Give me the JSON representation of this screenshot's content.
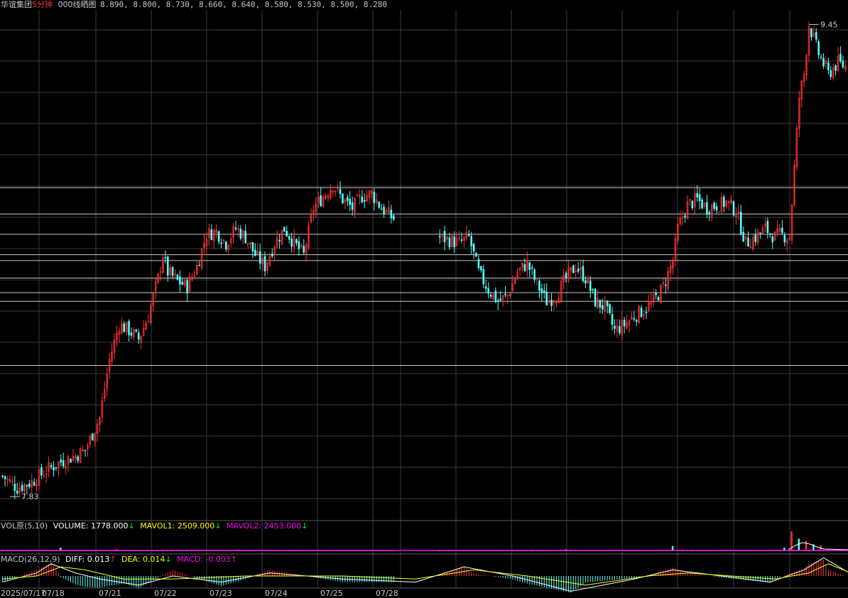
{
  "header": {
    "stock_name": "华谊集团",
    "period": "5分钟",
    "indicator_name": "000线晒图",
    "indicator_values": "8.890, 8.800, 8.730, 8.660, 8.640, 8.580, 8.530, 8.500, 8.280"
  },
  "vol_panel": {
    "name": "VOL原(5,10)",
    "volume_label": "VOLUME: 1778.000",
    "volume_arrow": "↓",
    "mavol1_label": "MAVOL1: 2509.000",
    "mavol1_arrow": "↓",
    "mavol2_label": "MAVOL2: 2453.000",
    "mavol2_arrow": "↓"
  },
  "macd_panel": {
    "name": "MACD(26,12,9)",
    "diff_label": "DIFF: 0.013",
    "diff_arrow": "↑",
    "dea_label": "DEA: 0.014",
    "dea_arrow": "↓",
    "macd_label": "MACD: -0.003",
    "macd_arrow": "↑"
  },
  "colors": {
    "background": "#000000",
    "up": "#ff3232",
    "down": "#54ffff",
    "grid": "#3c3c3c",
    "hline": "#c8c8c8",
    "mavol1": "#ffffff",
    "mavol2": "#ff00ff",
    "diff": "#ffff00",
    "dea": "#ffffff",
    "label_red": "#ff3232",
    "label_yellow": "#ffff00",
    "label_magenta": "#ff00ff",
    "label_green": "#00ff00"
  },
  "chart_data": {
    "type": "candlestick",
    "interval": "5min",
    "dates": [
      "2025/07/17",
      "07/18",
      "07/21",
      "07/22",
      "07/23",
      "07/24",
      "07/25",
      "07/28"
    ],
    "ylim": [
      7.75,
      9.5
    ],
    "high_label": "9.45",
    "low_label": "7.83",
    "levels": [
      8.89,
      8.8,
      8.73,
      8.66,
      8.64,
      8.58,
      8.53,
      8.5,
      8.28
    ],
    "close_path": [
      {
        "x": 0,
        "y": 7.9
      },
      {
        "x": 6,
        "y": 7.86
      },
      {
        "x": 12,
        "y": 7.88
      },
      {
        "x": 18,
        "y": 7.92
      },
      {
        "x": 24,
        "y": 7.95
      },
      {
        "x": 30,
        "y": 7.97
      },
      {
        "x": 34,
        "y": 7.99
      },
      {
        "x": 40,
        "y": 8.1
      },
      {
        "x": 44,
        "y": 8.3
      },
      {
        "x": 48,
        "y": 8.42
      },
      {
        "x": 52,
        "y": 8.4
      },
      {
        "x": 56,
        "y": 8.37
      },
      {
        "x": 60,
        "y": 8.45
      },
      {
        "x": 64,
        "y": 8.58
      },
      {
        "x": 66,
        "y": 8.66
      },
      {
        "x": 68,
        "y": 8.6
      },
      {
        "x": 72,
        "y": 8.57
      },
      {
        "x": 76,
        "y": 8.55
      },
      {
        "x": 80,
        "y": 8.62
      },
      {
        "x": 84,
        "y": 8.73
      },
      {
        "x": 88,
        "y": 8.74
      },
      {
        "x": 92,
        "y": 8.7
      },
      {
        "x": 96,
        "y": 8.75
      },
      {
        "x": 100,
        "y": 8.72
      },
      {
        "x": 104,
        "y": 8.66
      },
      {
        "x": 108,
        "y": 8.62
      },
      {
        "x": 112,
        "y": 8.7
      },
      {
        "x": 116,
        "y": 8.75
      },
      {
        "x": 120,
        "y": 8.7
      },
      {
        "x": 124,
        "y": 8.66
      },
      {
        "x": 128,
        "y": 8.82
      },
      {
        "x": 132,
        "y": 8.86
      },
      {
        "x": 136,
        "y": 8.9
      },
      {
        "x": 140,
        "y": 8.85
      },
      {
        "x": 144,
        "y": 8.82
      },
      {
        "x": 148,
        "y": 8.86
      },
      {
        "x": 152,
        "y": 8.87
      },
      {
        "x": 156,
        "y": 8.82
      },
      {
        "x": 160,
        "y": 8.79
      },
      {
        "x": 164,
        "y": 8.77
      },
      {
        "x": 168,
        "y": 8.76
      },
      {
        "x": 172,
        "y": 8.75
      },
      {
        "x": 176,
        "y": 8.74
      },
      {
        "x": 180,
        "y": 8.72
      },
      {
        "x": 184,
        "y": 8.71
      },
      {
        "x": 188,
        "y": 8.7
      },
      {
        "x": 192,
        "y": 8.72
      },
      {
        "x": 196,
        "y": 8.6
      },
      {
        "x": 200,
        "y": 8.54
      },
      {
        "x": 204,
        "y": 8.5
      },
      {
        "x": 208,
        "y": 8.52
      },
      {
        "x": 212,
        "y": 8.6
      },
      {
        "x": 216,
        "y": 8.63
      },
      {
        "x": 220,
        "y": 8.56
      },
      {
        "x": 224,
        "y": 8.5
      },
      {
        "x": 228,
        "y": 8.52
      },
      {
        "x": 232,
        "y": 8.58
      },
      {
        "x": 236,
        "y": 8.62
      },
      {
        "x": 240,
        "y": 8.58
      },
      {
        "x": 244,
        "y": 8.5
      },
      {
        "x": 248,
        "y": 8.48
      },
      {
        "x": 252,
        "y": 8.4
      },
      {
        "x": 256,
        "y": 8.42
      },
      {
        "x": 260,
        "y": 8.45
      },
      {
        "x": 264,
        "y": 8.47
      },
      {
        "x": 268,
        "y": 8.5
      },
      {
        "x": 272,
        "y": 8.55
      },
      {
        "x": 276,
        "y": 8.64
      },
      {
        "x": 278,
        "y": 8.75
      },
      {
        "x": 282,
        "y": 8.83
      },
      {
        "x": 286,
        "y": 8.85
      },
      {
        "x": 290,
        "y": 8.82
      },
      {
        "x": 294,
        "y": 8.83
      },
      {
        "x": 298,
        "y": 8.84
      },
      {
        "x": 302,
        "y": 8.81
      },
      {
        "x": 306,
        "y": 8.7
      },
      {
        "x": 310,
        "y": 8.72
      },
      {
        "x": 314,
        "y": 8.75
      },
      {
        "x": 318,
        "y": 8.72
      },
      {
        "x": 320,
        "y": 8.73
      },
      {
        "x": 324,
        "y": 8.72
      },
      {
        "x": 328,
        "y": 9.2
      },
      {
        "x": 330,
        "y": 9.28
      },
      {
        "x": 332,
        "y": 9.45
      },
      {
        "x": 336,
        "y": 9.35
      },
      {
        "x": 340,
        "y": 9.28
      },
      {
        "x": 344,
        "y": 9.32
      },
      {
        "x": 348,
        "y": 9.3
      }
    ],
    "ohlc_count": 348,
    "volume": {
      "last": 1778.0,
      "mavol1": 2509.0,
      "mavol2": 2453.0,
      "spikes": [
        {
          "x": 24,
          "v": 0.6
        },
        {
          "x": 47,
          "v": 0.4
        },
        {
          "x": 97,
          "v": 0.3
        },
        {
          "x": 172,
          "v": 0.3
        },
        {
          "x": 232,
          "v": 0.3
        },
        {
          "x": 276,
          "v": 0.9
        },
        {
          "x": 322,
          "v": 0.6
        },
        {
          "x": 325,
          "v": 3.5
        },
        {
          "x": 328,
          "v": 2.2
        },
        {
          "x": 331,
          "v": 1.8
        },
        {
          "x": 334,
          "v": 1.2
        },
        {
          "x": 337,
          "v": 1.0
        },
        {
          "x": 348,
          "v": 1.3
        }
      ]
    },
    "macd": {
      "diff_last": 0.013,
      "dea_last": 0.014,
      "macd_last": -0.003,
      "diff_path": [
        {
          "x": 0,
          "y": -0.02
        },
        {
          "x": 14,
          "y": 0.01
        },
        {
          "x": 20,
          "y": 0.04
        },
        {
          "x": 30,
          "y": 0.01
        },
        {
          "x": 40,
          "y": -0.01
        },
        {
          "x": 56,
          "y": -0.03
        },
        {
          "x": 70,
          "y": 0.0
        },
        {
          "x": 90,
          "y": -0.02
        },
        {
          "x": 110,
          "y": 0.01
        },
        {
          "x": 140,
          "y": -0.01
        },
        {
          "x": 170,
          "y": -0.02
        },
        {
          "x": 190,
          "y": 0.03
        },
        {
          "x": 210,
          "y": 0.0
        },
        {
          "x": 234,
          "y": -0.05
        },
        {
          "x": 260,
          "y": -0.01
        },
        {
          "x": 276,
          "y": 0.02
        },
        {
          "x": 296,
          "y": 0.0
        },
        {
          "x": 316,
          "y": -0.02
        },
        {
          "x": 330,
          "y": 0.02
        },
        {
          "x": 338,
          "y": 0.06
        },
        {
          "x": 348,
          "y": 0.013
        }
      ],
      "dea_path": [
        {
          "x": 0,
          "y": -0.01
        },
        {
          "x": 14,
          "y": 0.0
        },
        {
          "x": 24,
          "y": 0.03
        },
        {
          "x": 34,
          "y": 0.02
        },
        {
          "x": 50,
          "y": -0.01
        },
        {
          "x": 70,
          "y": -0.01
        },
        {
          "x": 100,
          "y": 0.0
        },
        {
          "x": 140,
          "y": 0.0
        },
        {
          "x": 170,
          "y": -0.01
        },
        {
          "x": 194,
          "y": 0.02
        },
        {
          "x": 216,
          "y": 0.0
        },
        {
          "x": 240,
          "y": -0.03
        },
        {
          "x": 266,
          "y": 0.0
        },
        {
          "x": 282,
          "y": 0.01
        },
        {
          "x": 300,
          "y": 0.0
        },
        {
          "x": 318,
          "y": -0.01
        },
        {
          "x": 332,
          "y": 0.01
        },
        {
          "x": 340,
          "y": 0.04
        },
        {
          "x": 348,
          "y": 0.014
        }
      ]
    }
  }
}
